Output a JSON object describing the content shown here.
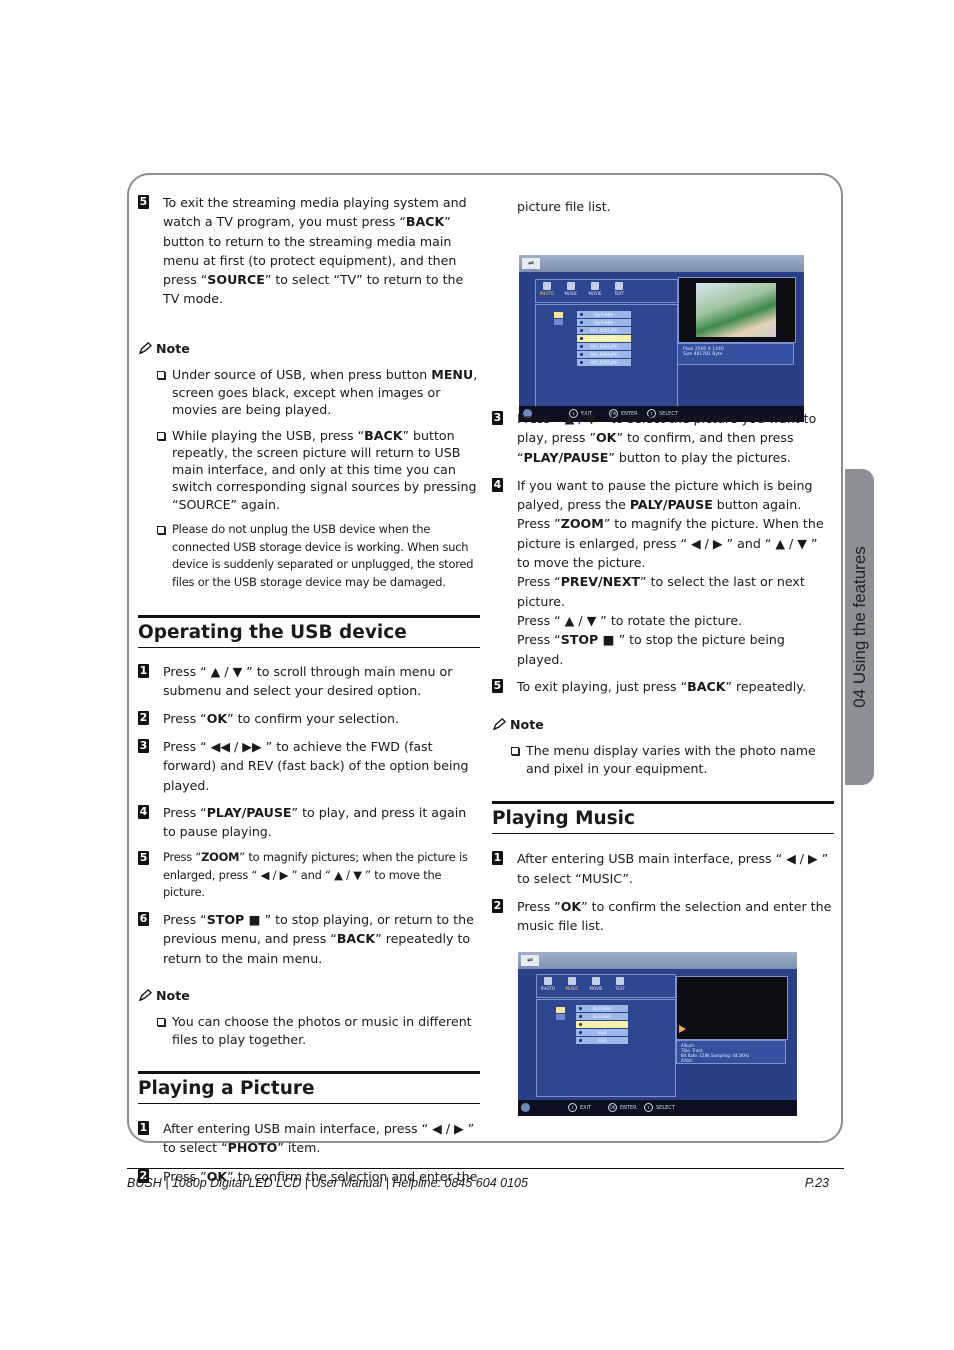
{
  "side_tab": {
    "label": "04 Using the features"
  },
  "left": {
    "step5_intro": {
      "num": "5",
      "parts": [
        "To exit the streaming media playing system and watch a TV program, you must press “",
        "BACK",
        "” button to return to the streaming media main menu at first (to protect equipment), and then press “",
        "SOURCE",
        "” to select “TV” to return to the TV mode."
      ]
    },
    "note1": {
      "title": "Note",
      "items": [
        {
          "parts": [
            "Under source of USB, when press button ",
            "MENU",
            ", screen goes black, except when images or movies are being played."
          ]
        },
        {
          "parts": [
            "While playing the USB, press “",
            "BACK",
            "” button repeatly, the screen picture will return to USB main interface, and only at this time you can switch corresponding signal sources by pressing “SOURCE” again."
          ]
        },
        {
          "parts": [
            "Please do not unplug the USB device when the connected USB storage device is working. When such device is suddenly separated or unplugged, the stored files or the USB storage device may be damaged."
          ]
        }
      ]
    },
    "section_usb": {
      "title": "Operating the USB device",
      "steps": [
        {
          "num": "1",
          "parts": [
            "Press “ ▲ / ▼ ” to scroll through main menu or submenu and select your desired option."
          ]
        },
        {
          "num": "2",
          "parts": [
            "Press “",
            "OK",
            "” to confirm your selection."
          ]
        },
        {
          "num": "3",
          "parts": [
            "Press “ ◀◀ / ▶▶ ” to achieve the FWD (fast forward) and REV (fast back) of the option being played."
          ]
        },
        {
          "num": "4",
          "parts": [
            "Press “",
            "PLAY/PAUSE",
            "” to play, and press it again to pause playing."
          ]
        },
        {
          "num": "5",
          "parts": [
            "Press “",
            "ZOOM",
            "” to magnify pictures; when the picture is enlarged, press “ ◀ / ▶ ” and “ ▲ / ▼ ” to move the picture."
          ]
        },
        {
          "num": "6",
          "parts": [
            "Press “",
            "STOP ■",
            " ” to stop playing, or return to the previous menu, and press “",
            "BACK",
            "” repeatedly to return to the main menu."
          ]
        }
      ]
    },
    "note2": {
      "title": "Note",
      "items": [
        {
          "parts": [
            "You can choose the photos or music in different files to play together."
          ]
        }
      ]
    },
    "section_picture": {
      "title": "Playing a Picture",
      "steps": [
        {
          "num": "1",
          "parts": [
            "After entering USB main interface, press “ ◀ / ▶ ” to select “",
            "PHOTO",
            "” item."
          ]
        },
        {
          "num": "2",
          "parts": [
            "Press ”",
            "OK",
            "” to confirm the selection and enter the"
          ]
        }
      ]
    }
  },
  "right": {
    "continuation": "picture file list.",
    "photo_screen": {
      "categories": [
        "PHOTO",
        "MUSIC",
        "MOVIE",
        "TEXT"
      ],
      "active_category": "PHOTO",
      "files": [
        "Up Folder",
        "Up Folder",
        "001_0001.JPG",
        "002_0002.JPG",
        "003_0003.JPG",
        "004_0004.JPG",
        "005_0005.JPG"
      ],
      "selected_index": 3,
      "info_lines": [
        "Pixel   2560 X 1440",
        "Size    481781 Byte"
      ],
      "hints": [
        "EXIT",
        "ENTER",
        "SELECT"
      ]
    },
    "picture_steps": [
      {
        "num": "3",
        "parts": [
          "Press “ ▲ / ▼ ” to select the picture you want to play, press ”",
          "OK",
          "” to confirm, and then press “",
          "PLAY/PAUSE",
          "” button to play the pictures."
        ]
      },
      {
        "num": "4",
        "parts": [
          "If you want to pause the picture which is being palyed, press the ",
          "PALY/PAUSE",
          " button again.\nPress ”",
          "ZOOM",
          "” to magnify the picture. When the picture is enlarged, press “ ◀ / ▶ ” and “ ▲ / ▼ ” to move the picture.\nPress “",
          "PREV/NEXT",
          "” to select the last or next picture.\nPress “ ▲ / ▼ ” to rotate the picture.\nPress “",
          "STOP ■",
          " ” to stop the picture being played."
        ]
      },
      {
        "num": "5",
        "parts": [
          "To exit playing, just press “",
          "BACK",
          "” repeatedly."
        ]
      }
    ],
    "note3": {
      "title": "Note",
      "items": [
        {
          "parts": [
            "The menu display varies with the photo name and pixel in your equipment."
          ]
        }
      ]
    },
    "section_music": {
      "title": "Playing Music",
      "steps": [
        {
          "num": "1",
          "parts": [
            "After entering USB main interface, press “ ◀ / ▶ ” to select “MUSIC”."
          ]
        },
        {
          "num": "2",
          "parts": [
            "Press ”",
            "OK",
            "” to confirm the selection and enter the music file list."
          ]
        }
      ]
    },
    "music_screen": {
      "categories": [
        "PHOTO",
        "MUSIC",
        "MOVIE",
        "TEXT"
      ],
      "active_category": "MUSIC",
      "files": [
        "Up Folder",
        "Up Folder",
        "",
        "mp3",
        "mp3"
      ],
      "selected_index": 2,
      "info_lines": [
        "Album:",
        "Title:  Track",
        "Bit Rate: 128K        Sampling: 44.1KHz",
        "Artist:"
      ],
      "hints": [
        "EXIT",
        "ENTER",
        "SELECT"
      ]
    }
  },
  "footer": {
    "left": "BUSH  | 1080p  Digital LED LCD | User Manual | Helpline: 0845 604 0105",
    "page": "P.23"
  }
}
